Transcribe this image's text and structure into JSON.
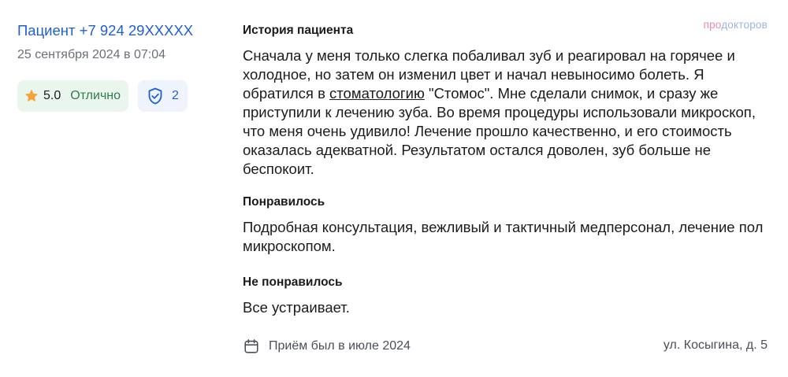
{
  "patient": {
    "name": "Пациент +7 924 29XXXXX",
    "date": "25 сентября 2024 в 07:04"
  },
  "rating": {
    "value": "5.0",
    "label": "Отлично",
    "icon": "star-icon",
    "color": "#f4a43a"
  },
  "verification": {
    "icon": "shield-check-icon",
    "count": "2"
  },
  "brand": {
    "part1": "про",
    "part2": "докторов"
  },
  "review": {
    "history_title": "История пациента",
    "history_text_before": "Сначала у меня только слегка побаливал зуб и реагировал на горячее и холодное, но затем он изменил цвет и начал невыносимо болеть. Я обратился в ",
    "history_link": "стоматологию",
    "history_text_after": " \"Стомос\". Мне сделали снимок, и сразу же приступили к лечению зуба. Во время процедуры использовали микроскоп, что меня очень удивило! Лечение прошло качественно, и его стоимость оказалась адекватной. Результатом остался доволен, зуб больше не беспокоит.",
    "liked_title": "Понравилось",
    "liked_text": "Подробная консультация, вежливый и тактичный медперсонал, лечение пол микроскопом.",
    "disliked_title": "Не понравилось",
    "disliked_text": "Все устраивает."
  },
  "footer": {
    "visit_icon": "calendar-icon",
    "visit_text": "Приём был в июле 2024",
    "address": "ул. Косыгина, д. 5"
  },
  "colors": {
    "link_blue": "#1f5fd6",
    "rating_bg": "#eaf5ee",
    "rating_text": "#2f7d4a",
    "shield_bg": "#eef3fc"
  }
}
